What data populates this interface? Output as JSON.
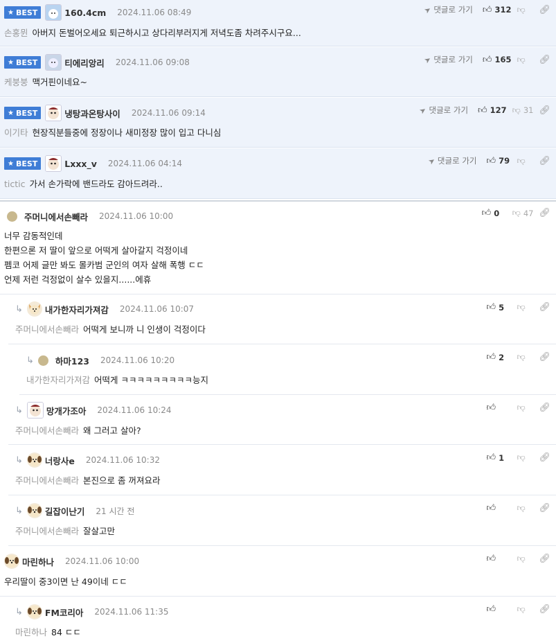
{
  "comments": [
    {
      "best": true,
      "nick": "160.4cm",
      "date": "2024.11.06 08:49",
      "target": "손홍뮌",
      "text": "아버지 돈벌어오세요 퇴근하시고 상다리부러지게 저녁도좀 차려주시구요...",
      "likes": "312",
      "dislikes": "",
      "goto": "댓글로 가기"
    },
    {
      "best": true,
      "nick": "티에리앙리",
      "date": "2024.11.06 09:08",
      "target": "케붕붕",
      "text": "맥거핀이네요~",
      "likes": "165",
      "dislikes": "",
      "goto": "댓글로 가기"
    },
    {
      "best": true,
      "nick": "냉탕과온탕사이",
      "date": "2024.11.06 09:14",
      "target": "이기타",
      "text": "현장직분들중에 정장이나 새미정장 많이 입고 다니심",
      "likes": "127",
      "dislikes": "31",
      "goto": "댓글로 가기"
    },
    {
      "best": true,
      "nick": "Lxxx_v",
      "date": "2024.11.06 04:14",
      "target": "tictic",
      "text": "가서 손가락에 밴드라도 감아드려라..",
      "likes": "79",
      "dislikes": "",
      "goto": "댓글로 가기"
    },
    {
      "best": false,
      "nick": "주머니에서손빼라",
      "date": "2024.11.06 10:00",
      "lines": [
        "너무 감동적인데",
        "한편으론 저 딸이 앞으로 어떡게 살아갈지 걱정이네",
        "펨코 어제 글만 봐도 몰카범 군인의 여자 살해 폭행 ㄷㄷ",
        "언제 저런 걱정없이 살수 있을지......에휴"
      ],
      "likes": "0",
      "dislikes": "47"
    },
    {
      "best": false,
      "nick": "내가한자리가져감",
      "date": "2024.11.06 10:07",
      "target": "주머니에서손빼라",
      "text": "어떡게 보니까 니 인생이 걱정이다",
      "likes": "5",
      "dislikes": ""
    },
    {
      "best": false,
      "nick": "하마123",
      "date": "2024.11.06 10:20",
      "target": "내가한자리가져감",
      "text": "어떡게 ㅋㅋㅋㅋㅋㅋㅋㅋㅋ능지",
      "likes": "2",
      "dislikes": ""
    },
    {
      "best": false,
      "nick": "망개가조아",
      "date": "2024.11.06 10:24",
      "target": "주머니에서손빼라",
      "text": "왜 그러고 살아?",
      "likes": "",
      "dislikes": ""
    },
    {
      "best": false,
      "nick": "너랑사e",
      "date": "2024.11.06 10:32",
      "target": "주머니에서손빼라",
      "text": "본진으로 좀 꺼져요라",
      "likes": "1",
      "dislikes": ""
    },
    {
      "best": false,
      "nick": "길잡이난기",
      "date": "21 시간 전",
      "target": "주머니에서손빼라",
      "text": "잘살고만",
      "likes": "",
      "dislikes": ""
    },
    {
      "best": false,
      "nick": "마린하나",
      "date": "2024.11.06 10:00",
      "text": "우리딸이 중3이면 난 49이네 ㄷㄷ",
      "likes": "",
      "dislikes": ""
    },
    {
      "best": false,
      "nick": "FM코리아",
      "date": "2024.11.06 11:35",
      "target": "마린하나",
      "text": "84 ㄷㄷ",
      "likes": "",
      "dislikes": ""
    }
  ],
  "badge_label": "BEST",
  "colors": {
    "badge": "#3f7dd6",
    "best_bg": "#eef3fb",
    "target": "#9a9a9a"
  },
  "icons": {
    "like": "thumbs-up-icon",
    "dislike": "thumbs-down-icon",
    "link": "link-icon",
    "goto": "arrow-icon",
    "reply": "reply-arrow-icon"
  }
}
